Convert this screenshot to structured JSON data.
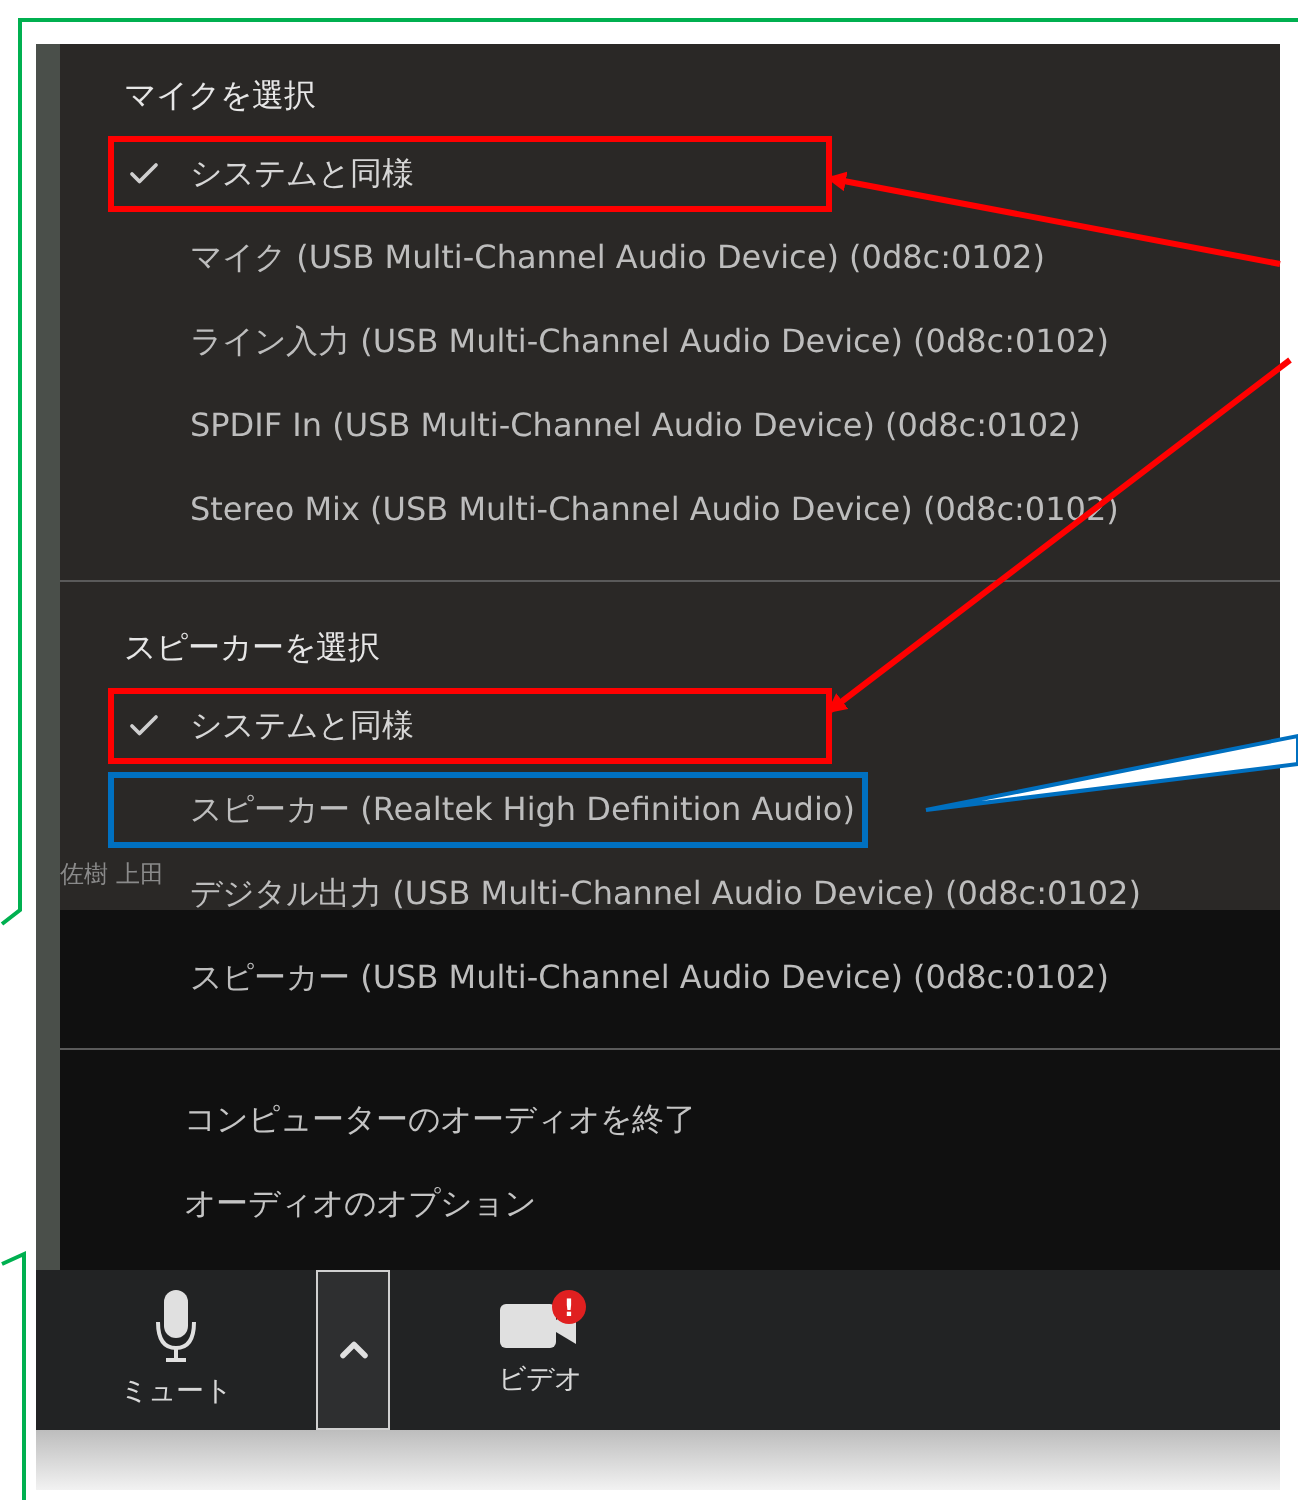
{
  "mic_section": {
    "title": "マイクを選択",
    "items": [
      {
        "label": "システムと同様",
        "selected": true,
        "color": "#ff0000"
      },
      {
        "label": "マイク (USB Multi-Channel Audio Device) (0d8c:0102)",
        "selected": false
      },
      {
        "label": "ライン入力 (USB Multi-Channel Audio Device) (0d8c:0102)",
        "selected": false
      },
      {
        "label": "SPDIF In (USB Multi-Channel Audio Device) (0d8c:0102)",
        "selected": false
      },
      {
        "label": "Stereo Mix (USB Multi-Channel Audio Device) (0d8c:0102)",
        "selected": false
      }
    ]
  },
  "speaker_section": {
    "title": "スピーカーを選択",
    "items": [
      {
        "label": "システムと同様",
        "selected": true,
        "color": "#ff0000"
      },
      {
        "label": "スピーカー (Realtek High Definition Audio)",
        "selected": false,
        "color": "#0070c0"
      },
      {
        "label": "デジタル出力 (USB Multi-Channel Audio Device) (0d8c:0102)",
        "selected": false
      },
      {
        "label": "スピーカー (USB Multi-Channel Audio Device) (0d8c:0102)",
        "selected": false
      }
    ]
  },
  "actions": [
    "コンピューターのオーディオを終了",
    "オーディオのオプション"
  ],
  "participant_name": "佐樹 上田",
  "toolbar": {
    "mute": {
      "label": "ミュート"
    },
    "video": {
      "label": "ビデオ",
      "alert": "!"
    }
  }
}
